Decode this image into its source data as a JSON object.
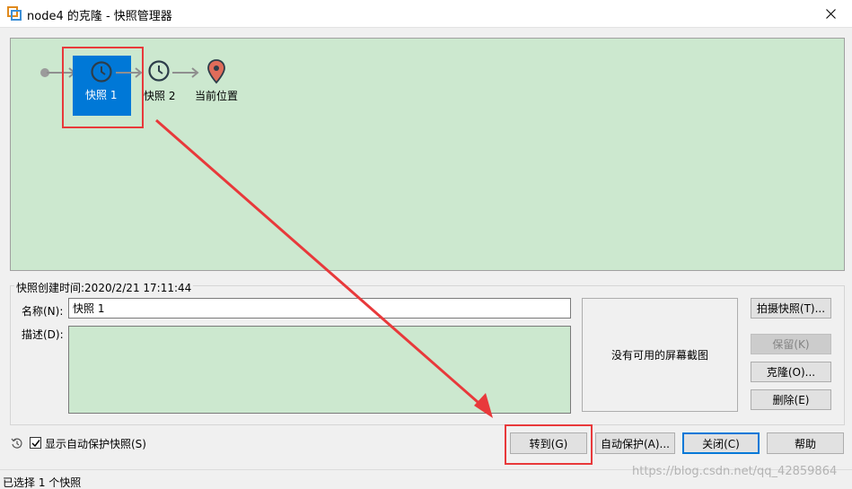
{
  "window": {
    "title": "node4 的克隆 - 快照管理器"
  },
  "tree": {
    "snapshots": [
      {
        "label": "快照 1",
        "selected": true,
        "icon": "clock-icon"
      },
      {
        "label": "快照 2",
        "selected": false,
        "icon": "clock-icon"
      }
    ],
    "current_position_label": "当前位置",
    "current_position_icon": "location-pin-icon",
    "colors": {
      "background": "#cce8cf",
      "selected": "#0078d7",
      "pin": "#e06c5a",
      "annotation": "#e8393b"
    }
  },
  "details": {
    "created_text": "快照创建时间:2020/2/21 17:11:44",
    "name_label": "名称(N):",
    "name_value": "快照 1",
    "desc_label": "描述(D):",
    "desc_value": "",
    "screenshot_text": "没有可用的屏幕截图"
  },
  "side_buttons": {
    "take": "拍摄快照(T)...",
    "keep": "保留(K)",
    "clone": "克隆(O)...",
    "delete": "删除(E)"
  },
  "footer": {
    "show_autoprotect_label": "显示自动保护快照(S)",
    "show_autoprotect_checked": true,
    "goto": "转到(G)",
    "autoprotect": "自动保护(A)...",
    "close": "关闭(C)",
    "help": "帮助"
  },
  "status": {
    "text": "已选择 1 个快照"
  },
  "watermark": "https://blog.csdn.net/qq_42859864"
}
